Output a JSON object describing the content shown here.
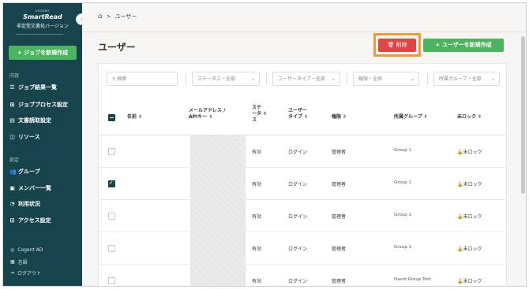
{
  "sidebar": {
    "logo_small": "COGENT",
    "logo_brand": "SmartRead",
    "logo_sub": "非定型文書化バージョン",
    "collapse_glyph": "‹",
    "new_job_label": "+ ジョブを新規作成",
    "section_content": "内容",
    "items_content": [
      {
        "icon": "list-icon",
        "glyph": "☰",
        "label": "ジョブ結果一覧"
      },
      {
        "icon": "process-icon",
        "glyph": "⊞",
        "label": "ジョブプロセス設定"
      },
      {
        "icon": "document-icon",
        "glyph": "▤",
        "label": "文書読取設定"
      },
      {
        "icon": "resource-icon",
        "glyph": "◫",
        "label": "リソース"
      }
    ],
    "section_settings": "設定",
    "items_settings": [
      {
        "icon": "group-icon",
        "glyph": "👥",
        "label": "グループ"
      },
      {
        "icon": "member-icon",
        "glyph": "▣",
        "label": "メンバー一覧"
      },
      {
        "icon": "usage-icon",
        "glyph": "◔",
        "label": "利用状況"
      },
      {
        "icon": "access-icon",
        "glyph": "⊡",
        "label": "アクセス設定"
      }
    ],
    "bottom": [
      {
        "icon": "account-icon",
        "glyph": "◎",
        "label": "Cogent AD"
      },
      {
        "icon": "language-icon",
        "glyph": "▦",
        "label": "言語"
      },
      {
        "icon": "logout-icon",
        "glyph": "⇥",
        "label": "ログアウト"
      }
    ]
  },
  "breadcrumb": {
    "home_glyph": "⌂",
    "sep": ">",
    "current": "ユーザー"
  },
  "page_title": "ユーザー",
  "actions": {
    "delete_label": "🗑 削除",
    "add_user_label": "+ ユーザーを新規作成"
  },
  "filters": {
    "search_placeholder": "検索",
    "status": "ステータス・全部",
    "user_type": "ユーザータイプ・全部",
    "role": "権限・全部",
    "group": "所属グループ・全部",
    "chevron": "⌄"
  },
  "table": {
    "headers": {
      "name": "名前 ⇳",
      "email_1": "メールアドレス /",
      "email_2": "APIキー ⇳",
      "status_1": "ステ",
      "status_2": "ータ ⇳",
      "status_3": "ス",
      "type_1": "ユーザー",
      "type_2": "タイプ ⇳",
      "role": "権限 ⇳",
      "group": "所属グループ ⇳",
      "lock": "未ロック ⇳"
    },
    "rows": [
      {
        "status": "有効",
        "type": "ログイン",
        "role": "管理者",
        "group": "Group 1",
        "lock": "🔓未ロック",
        "checked": false
      },
      {
        "status": "有効",
        "type": "ログイン",
        "role": "管理者",
        "group": "Group 1",
        "lock": "🔓未ロック",
        "checked": true
      },
      {
        "status": "有効",
        "type": "ログイン",
        "role": "管理者",
        "group": "Group 1",
        "lock": "🔓未ロック",
        "checked": false
      },
      {
        "status": "有効",
        "type": "ログイン",
        "role": "管理者",
        "group": "Group 1",
        "lock": "🔓未ロック",
        "checked": false
      },
      {
        "status": "有効",
        "type": "ログイン",
        "role": "管理者",
        "group": "David Group Test",
        "lock": "🔓未ロック",
        "checked": false
      }
    ]
  },
  "colors": {
    "sidebar": "#17434d",
    "primary_green": "#4cb35e",
    "delete_red": "#e04444",
    "highlight_orange": "#f39a34"
  }
}
